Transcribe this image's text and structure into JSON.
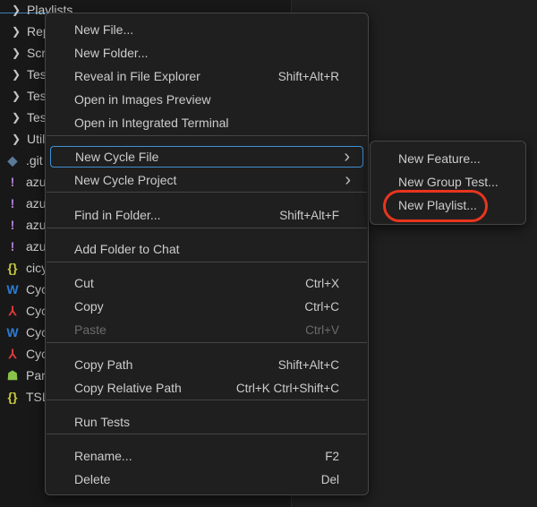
{
  "explorer": {
    "rows": [
      {
        "label": "Playlists",
        "kind": "folder"
      },
      {
        "label": "Rep",
        "kind": "folder"
      },
      {
        "label": "Scr",
        "kind": "folder"
      },
      {
        "label": "Tes",
        "kind": "folder"
      },
      {
        "label": "Tes",
        "kind": "folder"
      },
      {
        "label": "Tes",
        "kind": "folder"
      },
      {
        "label": "Util",
        "kind": "folder"
      },
      {
        "label": ".git",
        "kind": "git"
      },
      {
        "label": "azu",
        "kind": "exclaim"
      },
      {
        "label": "azu",
        "kind": "exclaim"
      },
      {
        "label": "azu",
        "kind": "exclaim"
      },
      {
        "label": "azu",
        "kind": "exclaim"
      },
      {
        "label": "cicy",
        "kind": "braces"
      },
      {
        "label": "Cyc",
        "kind": "word"
      },
      {
        "label": "Cyc",
        "kind": "pdf"
      },
      {
        "label": "Cyc",
        "kind": "word"
      },
      {
        "label": "Cyc",
        "kind": "pdf"
      },
      {
        "label": "Par",
        "kind": "android"
      },
      {
        "label": "TSL",
        "kind": "braces"
      }
    ],
    "icons": {
      "folder": {
        "glyph": "❯",
        "color": "#c5c5c5"
      },
      "git": {
        "glyph": "◆",
        "color": "#5a7a9a"
      },
      "exclaim": {
        "glyph": "!",
        "color": "#b180d7"
      },
      "braces": {
        "glyph": "{}",
        "color": "#cbcb41"
      },
      "word": {
        "glyph": "W",
        "color": "#2b7cd3"
      },
      "pdf": {
        "glyph": "⅄",
        "color": "#e23b3b"
      },
      "android": {
        "glyph": "☗",
        "color": "#8bc34a"
      }
    }
  },
  "context_menu": {
    "items": [
      {
        "label": "New File...",
        "shortcut": ""
      },
      {
        "label": "New Folder...",
        "shortcut": ""
      },
      {
        "label": "Reveal in File Explorer",
        "shortcut": "Shift+Alt+R"
      },
      {
        "label": "Open in Images Preview",
        "shortcut": ""
      },
      {
        "label": "Open in Integrated Terminal",
        "shortcut": ""
      },
      {
        "label": "New Cycle File",
        "shortcut": "",
        "submenu": true,
        "highlighted": true
      },
      {
        "label": "New Cycle Project",
        "shortcut": "",
        "submenu": true
      },
      {
        "label": "Find in Folder...",
        "shortcut": "Shift+Alt+F"
      },
      {
        "label": "Add Folder to Chat",
        "shortcut": ""
      },
      {
        "label": "Cut",
        "shortcut": "Ctrl+X"
      },
      {
        "label": "Copy",
        "shortcut": "Ctrl+C"
      },
      {
        "label": "Paste",
        "shortcut": "Ctrl+V",
        "disabled": true
      },
      {
        "label": "Copy Path",
        "shortcut": "Shift+Alt+C"
      },
      {
        "label": "Copy Relative Path",
        "shortcut": "Ctrl+K Ctrl+Shift+C"
      },
      {
        "label": "Run Tests",
        "shortcut": ""
      },
      {
        "label": "Rename...",
        "shortcut": "F2"
      },
      {
        "label": "Delete",
        "shortcut": "Del"
      }
    ]
  },
  "submenu": {
    "items": [
      {
        "label": "New Feature..."
      },
      {
        "label": "New Group Test..."
      },
      {
        "label": "New Playlist...",
        "annotated": true
      }
    ]
  },
  "colors": {
    "annotation": "#e8351e",
    "highlight_border": "#3f8fd2"
  }
}
